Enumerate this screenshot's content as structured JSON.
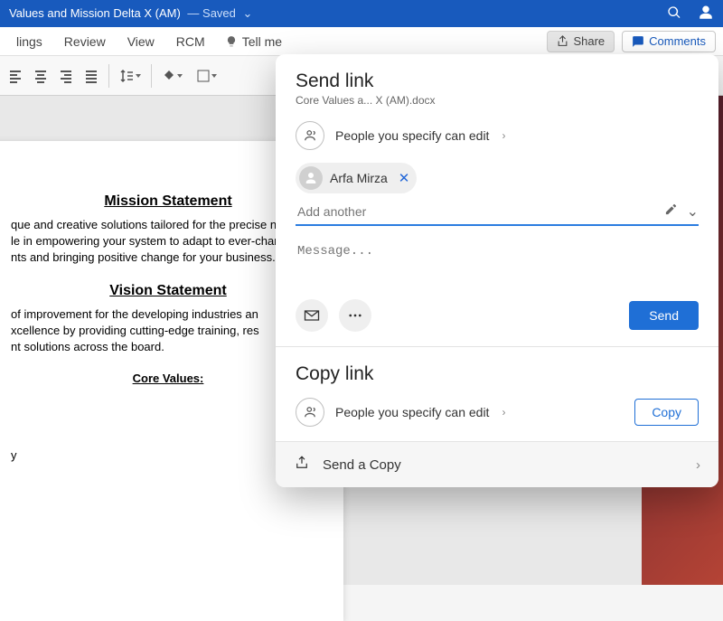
{
  "titlebar": {
    "doc_title": "Values and Mission Delta X (AM)",
    "saved_label": "— Saved"
  },
  "ribbon": {
    "tabs": [
      "lings",
      "Review",
      "View",
      "RCM"
    ],
    "tellme": "Tell me",
    "share": "Share",
    "comments": "Comments"
  },
  "document": {
    "mission_h": "Mission Statement",
    "mission_b": "que and creative solutions tailored for the precise n\nle in empowering your system to adapt to ever-chan\nnts and bringing positive change for your business.",
    "vision_h": "Vision Statement",
    "vision_b": "of improvement for the developing industries an\nxcellence by providing cutting-edge training, res\nnt solutions across the board.",
    "core_h": "Core Values:",
    "stray_y": "y"
  },
  "share_panel": {
    "send_title": "Send link",
    "filename": "Core Values a... X (AM).docx",
    "perm_text": "People you specify can edit",
    "recipient1": "Arfa Mirza",
    "add_placeholder": "Add another",
    "msg_placeholder": "Message...",
    "send_btn": "Send",
    "copy_title": "Copy link",
    "copy_perm": "People you specify can edit",
    "copy_btn": "Copy",
    "send_copy": "Send a Copy"
  }
}
